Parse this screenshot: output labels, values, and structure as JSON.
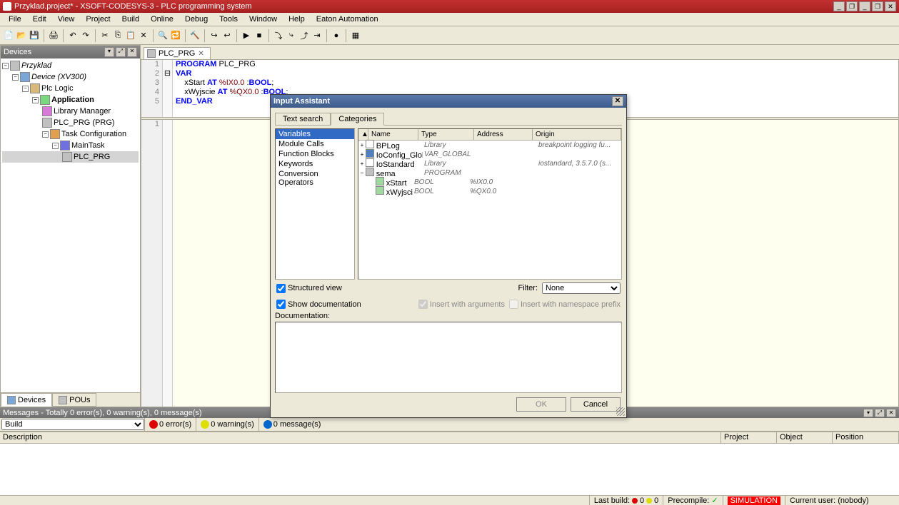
{
  "title": "Przyklad.project* - XSOFT-CODESYS-3 - PLC programming system",
  "menu": [
    "File",
    "Edit",
    "View",
    "Project",
    "Build",
    "Online",
    "Debug",
    "Tools",
    "Window",
    "Help",
    "Eaton Automation"
  ],
  "sidebar": {
    "header": "Devices",
    "tabs": {
      "devices": "Devices",
      "pous": "POUs"
    },
    "root": "Przyklad",
    "device": "Device (XV300)",
    "plc_logic": "Plc Logic",
    "application": "Application",
    "library_manager": "Library Manager",
    "plc_prg": "PLC_PRG (PRG)",
    "task_config": "Task Configuration",
    "main_task": "MainTask",
    "task_prg": "PLC_PRG"
  },
  "editor": {
    "tab": "PLC_PRG",
    "lines": {
      "l1_kw": "PROGRAM",
      "l1_id": " PLC_PRG",
      "l2_kw": "VAR",
      "l3_pre": "    xStart ",
      "l3_at": "AT",
      "l3_addr": " %IX0.0 ",
      "l3_colon": ":",
      "l3_type": "BOOL",
      "l3_semi": ";",
      "l4_pre": "    xWyjscie ",
      "l4_at": "AT",
      "l4_addr": " %QX0.0 ",
      "l4_colon": ":",
      "l4_type": "BOOL",
      "l4_semi": ";",
      "l5_kw": "END_VAR"
    }
  },
  "dialog": {
    "title": "Input Assistant",
    "tabs": {
      "text": "Text search",
      "cat": "Categories"
    },
    "categories": [
      "Variables",
      "Module Calls",
      "Function Blocks",
      "Keywords",
      "Conversion Operators"
    ],
    "cols": {
      "tri": "▲",
      "name": "Name",
      "type": "Type",
      "address": "Address",
      "origin": "Origin"
    },
    "rows": [
      {
        "exp": "+",
        "ico": "ico-braces",
        "name": "BPLog",
        "type": "Library",
        "addr": "",
        "origin": "breakpoint logging fu..."
      },
      {
        "exp": "+",
        "ico": "ico-globals",
        "name": "IoConfig_Globals",
        "type": "VAR_GLOBAL",
        "addr": "",
        "origin": ""
      },
      {
        "exp": "+",
        "ico": "ico-braces",
        "name": "IoStandard",
        "type": "Library",
        "addr": "",
        "origin": "iostandard, 3.5.7.0 (s..."
      },
      {
        "exp": "−",
        "ico": "ico-prg",
        "name": "sema",
        "type": "PROGRAM",
        "addr": "",
        "origin": ""
      },
      {
        "exp": "",
        "ico": "ico-var",
        "name": "xStart",
        "bold": true,
        "type": "BOOL",
        "addr": "%IX0.0",
        "origin": ""
      },
      {
        "exp": "",
        "ico": "ico-var",
        "name": "xWyjscie",
        "bold": true,
        "type": "BOOL",
        "addr": "%QX0.0",
        "origin": ""
      }
    ],
    "structured_view": "Structured view",
    "filter_label": "Filter:",
    "filter_value": "None",
    "show_doc": "Show documentation",
    "insert_args": "Insert with arguments",
    "insert_ns": "Insert with namespace prefix",
    "doc_label": "Documentation:",
    "ok": "OK",
    "cancel": "Cancel"
  },
  "messages": {
    "header": "Messages - Totally 0 error(s), 0 warning(s), 0 message(s)",
    "combo": "Build",
    "errors": "0 error(s)",
    "warnings": "0 warning(s)",
    "msgs": "0 message(s)",
    "cols": {
      "desc": "Description",
      "project": "Project",
      "object": "Object",
      "position": "Position"
    }
  },
  "status": {
    "last_build": "Last build:",
    "err0": "0",
    "warn0": "0",
    "precompile": "Precompile:",
    "sim": "SIMULATION",
    "user": "Current user: (nobody)"
  }
}
